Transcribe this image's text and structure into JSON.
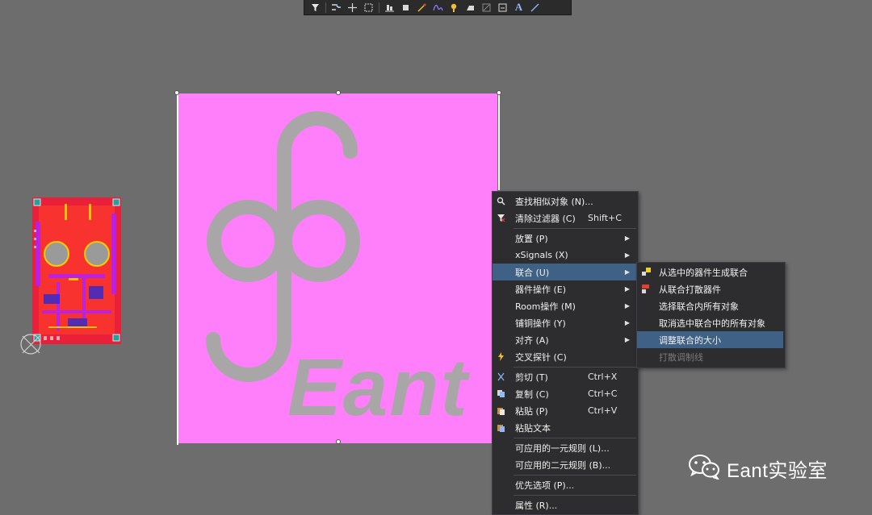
{
  "toolbar": {
    "buttons": [
      "filter-icon",
      "route-icon",
      "crosshair-icon",
      "select-area-icon",
      "align-icon",
      "component-icon",
      "interactive-route-icon",
      "differential-pair-icon",
      "place-pad-icon",
      "polygon-icon",
      "region-icon",
      "dimension-icon",
      "text-icon",
      "line-icon"
    ]
  },
  "canvas": {
    "logo_text": "Eant",
    "sheet_color": "#ff7ffa",
    "logo_color": "#a9a6a8"
  },
  "context_menu": {
    "items": [
      {
        "label": "查找相似对象 (N)...",
        "shortcut": "",
        "icon": "find-similar-icon",
        "submenu": false
      },
      {
        "label": "清除过滤器 (C)",
        "shortcut": "Shift+C",
        "icon": "clear-filter-icon",
        "submenu": false
      },
      {
        "label": "放置 (P)",
        "shortcut": "",
        "icon": "",
        "submenu": true
      },
      {
        "label": "xSignals (X)",
        "shortcut": "",
        "icon": "",
        "submenu": true
      },
      {
        "label": "联合 (U)",
        "shortcut": "",
        "icon": "",
        "submenu": true,
        "highlighted": true
      },
      {
        "label": "器件操作 (E)",
        "shortcut": "",
        "icon": "",
        "submenu": true
      },
      {
        "label": "Room操作 (M)",
        "shortcut": "",
        "icon": "",
        "submenu": true
      },
      {
        "label": "铺铜操作 (Y)",
        "shortcut": "",
        "icon": "",
        "submenu": true
      },
      {
        "label": "对齐 (A)",
        "shortcut": "",
        "icon": "",
        "submenu": true
      },
      {
        "label": "交叉探针 (C)",
        "shortcut": "",
        "icon": "cross-probe-icon",
        "submenu": false
      },
      {
        "label": "剪切 (T)",
        "shortcut": "Ctrl+X",
        "icon": "cut-icon",
        "submenu": false
      },
      {
        "label": "复制 (C)",
        "shortcut": "Ctrl+C",
        "icon": "copy-icon",
        "submenu": false
      },
      {
        "label": "粘贴 (P)",
        "shortcut": "Ctrl+V",
        "icon": "paste-icon",
        "submenu": false
      },
      {
        "label": "粘贴文本",
        "shortcut": "",
        "icon": "paste-text-icon",
        "submenu": false
      },
      {
        "label": "可应用的一元规则 (L)...",
        "shortcut": "",
        "icon": "",
        "submenu": false
      },
      {
        "label": "可应用的二元规则 (B)...",
        "shortcut": "",
        "icon": "",
        "submenu": false
      },
      {
        "label": "优先选项 (P)...",
        "shortcut": "",
        "icon": "",
        "submenu": false
      },
      {
        "label": "属性 (R)...",
        "shortcut": "",
        "icon": "",
        "submenu": false
      }
    ]
  },
  "union_submenu": {
    "items": [
      {
        "label": "从选中的器件生成联合",
        "icon": "create-union-icon",
        "highlighted": false,
        "disabled": false
      },
      {
        "label": "从联合打散器件",
        "icon": "break-union-icon",
        "highlighted": false,
        "disabled": false
      },
      {
        "label": "选择联合内所有对象",
        "icon": "",
        "highlighted": false,
        "disabled": false
      },
      {
        "label": "取消选中联合中的所有对象",
        "icon": "",
        "highlighted": false,
        "disabled": false
      },
      {
        "label": "调整联合的大小",
        "icon": "",
        "highlighted": true,
        "disabled": false
      },
      {
        "label": "打散调制线",
        "icon": "",
        "highlighted": false,
        "disabled": true
      }
    ]
  },
  "watermark": {
    "text": "Eant实验室",
    "icon": "wechat-icon"
  }
}
